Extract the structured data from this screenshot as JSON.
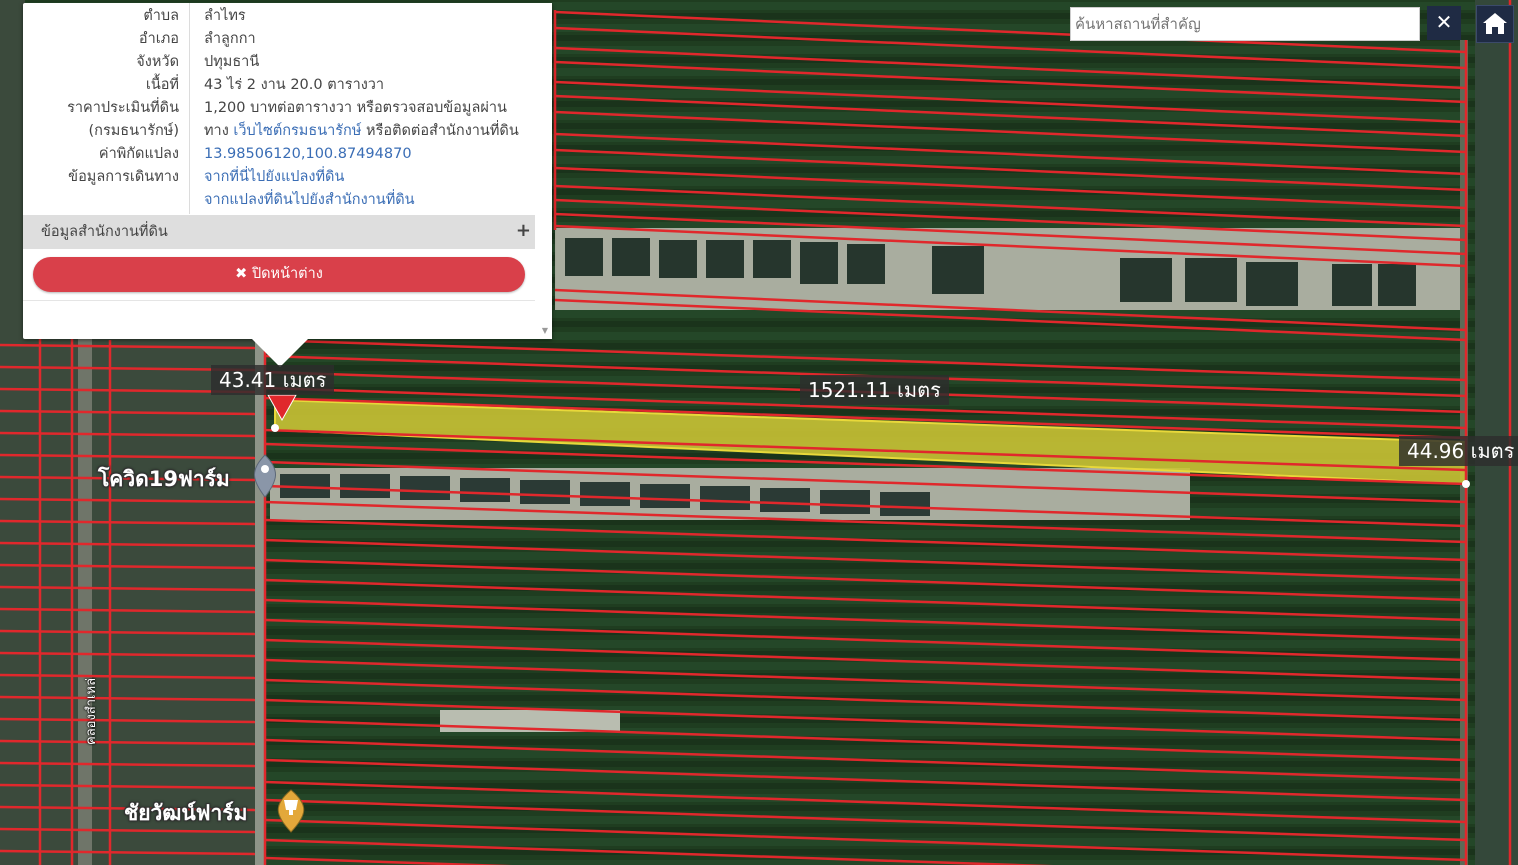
{
  "info_panel": {
    "rows": [
      {
        "label": "ตำบล",
        "value": "ลำไทร"
      },
      {
        "label": "อำเภอ",
        "value": "ลำลูกกา"
      },
      {
        "label": "จังหวัด",
        "value": "ปทุมธานี"
      },
      {
        "label": "เนื้อที่",
        "value": "43 ไร่ 2 งาน 20.0 ตารางวา"
      },
      {
        "label": "ราคาประเมินที่ดิน",
        "value": "1,200 บาทต่อตารางวา หรือตรวจสอบข้อมูลผ่าน"
      },
      {
        "label": "(กรมธนารักษ์)",
        "value_prefix": "ทาง ",
        "link": "เว็บไซต์กรมธนารักษ์",
        "value_suffix": " หรือติดต่อสำนักงานที่ดิน"
      },
      {
        "label": "ค่าพิกัดแปลง",
        "link": "13.98506120,100.87494870"
      },
      {
        "label": "ข้อมูลการเดินทาง",
        "link": "จากที่นี่ไปยังแปลงที่ดิน"
      },
      {
        "label": "",
        "link": "จากแปลงที่ดินไปยังสำนักงานที่ดิน"
      }
    ],
    "section_label": "ข้อมูลสำนักงานที่ดิน",
    "section_toggle": "+",
    "close_icon": "✖",
    "close_label": "ปิดหน้าต่าง"
  },
  "search": {
    "placeholder": "ค้นหาสถานที่สำคัญ",
    "clear_icon": "✕"
  },
  "measurements": {
    "west": "43.41 เมตร",
    "length": "1521.11 เมตร",
    "east": "44.96 เมตร"
  },
  "pois": {
    "farm1": "โควิด19ฟาร์ม",
    "farm2": "ชัยวัฒน์ฟาร์ม"
  },
  "road_label": "คลองสำเหล่",
  "colors": {
    "parcel_line": "#e0282c",
    "highlight": "#c9c234",
    "button": "#d9404a",
    "nav_dark": "#1f2b44",
    "link": "#3a6db5"
  }
}
